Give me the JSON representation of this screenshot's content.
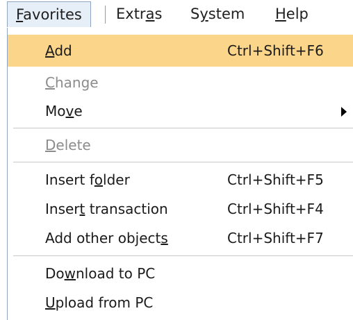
{
  "menubar": {
    "favorites_pre": "",
    "favorites_ul": "F",
    "favorites_post": "avorites",
    "extras_pre": "Extr",
    "extras_ul": "a",
    "extras_post": "s",
    "system_pre": "S",
    "system_ul": "y",
    "system_post": "stem",
    "help_pre": "",
    "help_ul": "H",
    "help_post": "elp"
  },
  "dropdown": {
    "add": {
      "pre": "",
      "ul": "A",
      "post": "dd",
      "shortcut": "Ctrl+Shift+F6"
    },
    "change": {
      "pre": "",
      "ul": "C",
      "post": "hange"
    },
    "move": {
      "pre": "Mo",
      "ul": "v",
      "post": "e"
    },
    "delete": {
      "pre": "",
      "ul": "D",
      "post": "elete"
    },
    "insert_folder": {
      "pre": "Insert f",
      "ul": "o",
      "post": "lder",
      "shortcut": "Ctrl+Shift+F5"
    },
    "insert_transaction": {
      "pre": "Inser",
      "ul": "t",
      "post": " transaction",
      "shortcut": "Ctrl+Shift+F4"
    },
    "add_other_objects": {
      "pre": "Add other object",
      "ul": "s",
      "post": "",
      "shortcut": "Ctrl+Shift+F7"
    },
    "download_to_pc": {
      "pre": "Do",
      "ul": "w",
      "post": "nload to PC"
    },
    "upload_from_pc": {
      "pre": "",
      "ul": "U",
      "post": "pload from PC"
    }
  },
  "colors": {
    "highlight": "#fbd58a",
    "active_menubar_bg": "#e6eef7",
    "disabled_text": "#8c8c8c"
  }
}
